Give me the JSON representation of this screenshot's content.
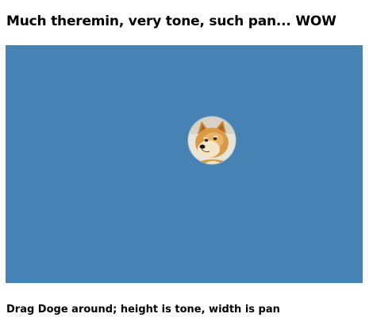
{
  "header": {
    "title": "Much theremin, very tone, such pan... WOW"
  },
  "stage": {
    "background_color": "#4682b4",
    "draggable": {
      "name": "doge",
      "icon": "doge-icon"
    }
  },
  "footer": {
    "instructions": "Drag Doge around; height is tone, width is pan"
  }
}
